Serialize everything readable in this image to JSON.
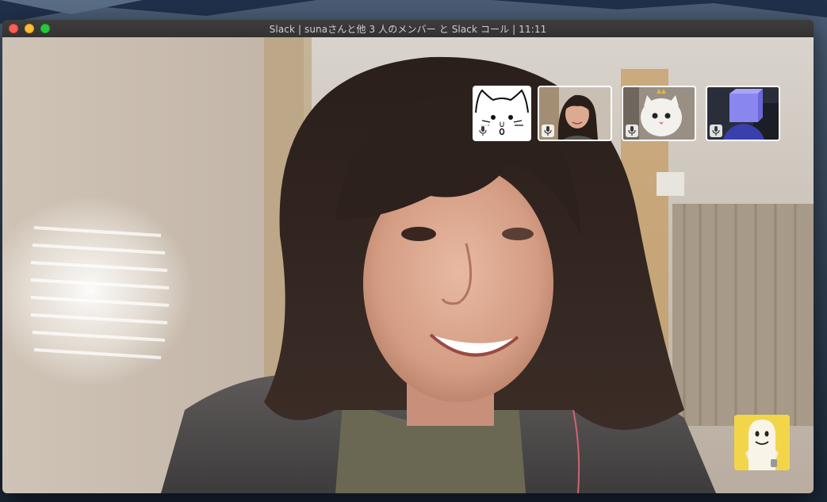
{
  "window": {
    "title": "Slack | sunaさんと他 3 人のメンバー と Slack コール | 11:11"
  },
  "traffic_lights": {
    "close": "close-button",
    "minimize": "minimize-button",
    "zoom": "zoom-button"
  },
  "participants": [
    {
      "name": "participant-cat-drawing",
      "icon": "microphone-icon"
    },
    {
      "name": "participant-woman",
      "icon": "microphone-icon"
    },
    {
      "name": "participant-white-cat",
      "icon": "microphone-icon"
    },
    {
      "name": "participant-blue-cube",
      "icon": "microphone-icon"
    }
  ],
  "self_view": {
    "icon": "ghost-avatar"
  },
  "colors": {
    "titlebar": "#323232",
    "thumb_border": "#ffffff",
    "self_view_bg": "#f3d54a",
    "close": "#fe5f57",
    "minimize": "#febc2e",
    "zoom": "#28c840"
  }
}
